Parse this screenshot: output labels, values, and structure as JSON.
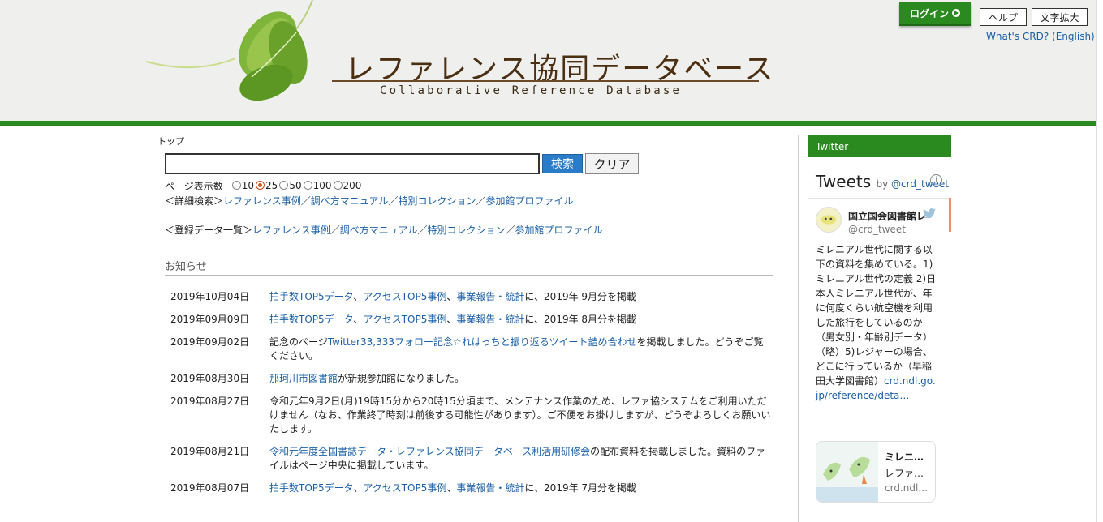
{
  "header": {
    "logo_title": "レファレンス協同データベース",
    "logo_subtitle": "Collaborative Reference Database",
    "login_label": "ログイン",
    "help_label": "ヘルプ",
    "zoom_label": "文字拡大",
    "whats_label": "What's CRD? (English)"
  },
  "breadcrumb": "トップ",
  "search": {
    "value": "",
    "search_label": "検索",
    "clear_label": "クリア"
  },
  "pagesize": {
    "label": "ページ表示数",
    "options": [
      "10",
      "25",
      "50",
      "100",
      "200"
    ],
    "selected": "25"
  },
  "detail_search": {
    "prefix": "＜詳細検索＞",
    "links": [
      "レファレンス事例",
      "調べ方マニュアル",
      "特別コレクション",
      "参加館プロファイル"
    ],
    "sep": "／"
  },
  "registered": {
    "prefix": "＜登録データ一覧＞",
    "links": [
      "レファレンス事例",
      "調べ方マニュアル",
      "特別コレクション",
      "参加館プロファイル"
    ],
    "sep": "／"
  },
  "notices": {
    "title": "お知らせ",
    "items": [
      {
        "date": "2019年10月04日",
        "parts": [
          {
            "t": "拍手数TOP5データ",
            "link": true
          },
          {
            "t": "、"
          },
          {
            "t": "アクセスTOP5事例",
            "link": true
          },
          {
            "t": "、"
          },
          {
            "t": "事業報告・統計",
            "link": true
          },
          {
            "t": "に、2019年 9月分を掲載"
          }
        ]
      },
      {
        "date": "2019年09月09日",
        "parts": [
          {
            "t": "拍手数TOP5データ",
            "link": true
          },
          {
            "t": "、"
          },
          {
            "t": "アクセスTOP5事例",
            "link": true
          },
          {
            "t": "、"
          },
          {
            "t": "事業報告・統計",
            "link": true
          },
          {
            "t": "に、2019年 8月分を掲載"
          }
        ]
      },
      {
        "date": "2019年09月02日",
        "parts": [
          {
            "t": "記念のページ"
          },
          {
            "t": "Twitter33,333フォロー記念☆れはっちと振り返るツイート詰め合わせ",
            "link": true
          },
          {
            "t": "を掲載しました。どうぞご覧ください。"
          }
        ]
      },
      {
        "date": "2019年08月30日",
        "parts": [
          {
            "t": "那珂川市図書館",
            "link": true
          },
          {
            "t": "が新規参加館になりました。"
          }
        ]
      },
      {
        "date": "2019年08月27日",
        "parts": [
          {
            "t": "令和元年9月2日(月)19時15分から20時15分頃まで、メンテナンス作業のため、レファ協システムをご利用いただけません（なお、作業終了時刻は前後する可能性があります）。ご不便をお掛けしますが、どうぞよろしくお願いいたします。"
          }
        ]
      },
      {
        "date": "2019年08月21日",
        "parts": [
          {
            "t": "令和元年度全国書誌データ・レファレンス協同データベース利活用研修会",
            "link": true
          },
          {
            "t": "の配布資料を掲載しました。資料のファイルはページ中央に掲載しています。"
          }
        ]
      },
      {
        "date": "2019年08月07日",
        "parts": [
          {
            "t": "拍手数TOP5データ",
            "link": true
          },
          {
            "t": "、"
          },
          {
            "t": "アクセスTOP5事例",
            "link": true
          },
          {
            "t": "、"
          },
          {
            "t": "事業報告・統計",
            "link": true
          },
          {
            "t": "に、2019年 7月分を掲載"
          }
        ]
      }
    ]
  },
  "twitter": {
    "header": "Twitter",
    "tweets_title": "Tweets",
    "by_word": "by",
    "by_handle": "@crd_tweet",
    "account_name": "国立国会図書館レ",
    "account_handle": "@crd_tweet",
    "tweet_text": "ミレニアル世代に関する以下の資料を集めている。1)ミレニアル世代の定義 2)日本人ミレニアル世代が、年に何度くらい航空機を利用した旅行をしているのか（男女別・年齢別データ）（略）5)レジャーの場合、どこに行っているか（早稲田大学図書館）",
    "tweet_link": "crd.ndl.go.jp/reference/deta…",
    "card_title": "ミレニ…",
    "card_desc": "レファ…",
    "card_url": "crd.ndl…"
  },
  "colors": {
    "brand_green": "#2a8a1f",
    "link_blue": "#1a5fa8",
    "search_blue": "#2a7cc8"
  }
}
